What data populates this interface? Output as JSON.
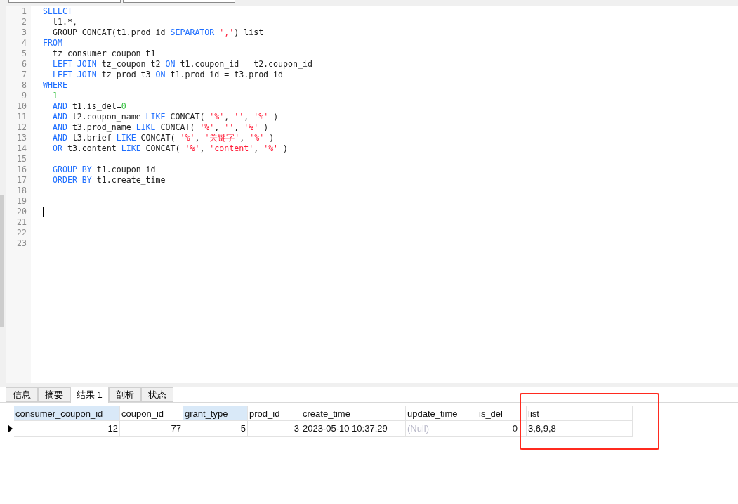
{
  "editor": {
    "lines": [
      {
        "number": "1",
        "tokens": [
          {
            "kind": "kw",
            "text": "SELECT"
          }
        ]
      },
      {
        "number": "2",
        "tokens": [
          {
            "kind": "plain",
            "text": "  t1.*,"
          }
        ]
      },
      {
        "number": "3",
        "tokens": [
          {
            "kind": "plain",
            "text": "  GROUP_CONCAT(t1.prod_id "
          },
          {
            "kind": "kw",
            "text": "SEPARATOR"
          },
          {
            "kind": "str",
            "text": " ','"
          },
          {
            "kind": "plain",
            "text": ") list"
          }
        ]
      },
      {
        "number": "4",
        "tokens": [
          {
            "kind": "kw",
            "text": "FROM"
          }
        ]
      },
      {
        "number": "5",
        "tokens": [
          {
            "kind": "plain",
            "text": "  tz_consumer_coupon t1"
          }
        ]
      },
      {
        "number": "6",
        "tokens": [
          {
            "kind": "kw",
            "text": "  LEFT JOIN"
          },
          {
            "kind": "plain",
            "text": " tz_coupon t2 "
          },
          {
            "kind": "kw",
            "text": "ON"
          },
          {
            "kind": "plain",
            "text": " t1.coupon_id = t2.coupon_id"
          }
        ]
      },
      {
        "number": "7",
        "tokens": [
          {
            "kind": "kw",
            "text": "  LEFT JOIN"
          },
          {
            "kind": "plain",
            "text": " tz_prod t3 "
          },
          {
            "kind": "kw",
            "text": "ON"
          },
          {
            "kind": "plain",
            "text": " t1.prod_id = t3.prod_id"
          }
        ]
      },
      {
        "number": "8",
        "tokens": [
          {
            "kind": "kw",
            "text": "WHERE"
          }
        ]
      },
      {
        "number": "9",
        "tokens": [
          {
            "kind": "num",
            "text": "  1"
          }
        ]
      },
      {
        "number": "10",
        "tokens": [
          {
            "kind": "kw",
            "text": "  AND"
          },
          {
            "kind": "plain",
            "text": " t1.is_del="
          },
          {
            "kind": "num",
            "text": "0"
          }
        ]
      },
      {
        "number": "11",
        "tokens": [
          {
            "kind": "kw",
            "text": "  AND"
          },
          {
            "kind": "plain",
            "text": " t2.coupon_name "
          },
          {
            "kind": "kw",
            "text": "LIKE"
          },
          {
            "kind": "plain",
            "text": " CONCAT( "
          },
          {
            "kind": "str",
            "text": "'%'"
          },
          {
            "kind": "plain",
            "text": ", "
          },
          {
            "kind": "str",
            "text": "''"
          },
          {
            "kind": "plain",
            "text": ", "
          },
          {
            "kind": "str",
            "text": "'%'"
          },
          {
            "kind": "plain",
            "text": " )"
          }
        ]
      },
      {
        "number": "12",
        "tokens": [
          {
            "kind": "kw",
            "text": "  AND"
          },
          {
            "kind": "plain",
            "text": " t3.prod_name "
          },
          {
            "kind": "kw",
            "text": "LIKE"
          },
          {
            "kind": "plain",
            "text": " CONCAT( "
          },
          {
            "kind": "str",
            "text": "'%'"
          },
          {
            "kind": "plain",
            "text": ", "
          },
          {
            "kind": "str",
            "text": "''"
          },
          {
            "kind": "plain",
            "text": ", "
          },
          {
            "kind": "str",
            "text": "'%'"
          },
          {
            "kind": "plain",
            "text": " )"
          }
        ]
      },
      {
        "number": "13",
        "tokens": [
          {
            "kind": "kw",
            "text": "  AND"
          },
          {
            "kind": "plain",
            "text": " t3.brief "
          },
          {
            "kind": "kw",
            "text": "LIKE"
          },
          {
            "kind": "plain",
            "text": " CONCAT( "
          },
          {
            "kind": "str",
            "text": "'%'"
          },
          {
            "kind": "plain",
            "text": ", "
          },
          {
            "kind": "str",
            "text": "'关键字'"
          },
          {
            "kind": "plain",
            "text": ", "
          },
          {
            "kind": "str",
            "text": "'%'"
          },
          {
            "kind": "plain",
            "text": " )"
          }
        ]
      },
      {
        "number": "14",
        "tokens": [
          {
            "kind": "kw",
            "text": "  OR"
          },
          {
            "kind": "plain",
            "text": " t3.content "
          },
          {
            "kind": "kw",
            "text": "LIKE"
          },
          {
            "kind": "plain",
            "text": " CONCAT( "
          },
          {
            "kind": "str",
            "text": "'%'"
          },
          {
            "kind": "plain",
            "text": ", "
          },
          {
            "kind": "str",
            "text": "'content'"
          },
          {
            "kind": "plain",
            "text": ", "
          },
          {
            "kind": "str",
            "text": "'%'"
          },
          {
            "kind": "plain",
            "text": " )"
          }
        ]
      },
      {
        "number": "15"
      },
      {
        "number": "16",
        "tokens": [
          {
            "kind": "kw",
            "text": "  GROUP BY"
          },
          {
            "kind": "plain",
            "text": " t1.coupon_id"
          }
        ]
      },
      {
        "number": "17",
        "tokens": [
          {
            "kind": "kw",
            "text": "  ORDER BY"
          },
          {
            "kind": "plain",
            "text": " t1.create_time"
          }
        ]
      },
      {
        "number": "18"
      },
      {
        "number": "19"
      },
      {
        "number": "20",
        "cursor": true
      },
      {
        "number": "21"
      },
      {
        "number": "22"
      },
      {
        "number": "23"
      }
    ]
  },
  "tabs": [
    {
      "label": "信息",
      "selected": false
    },
    {
      "label": "摘要",
      "selected": false
    },
    {
      "label": "结果 1",
      "selected": true
    },
    {
      "label": "剖析",
      "selected": false
    },
    {
      "label": "状态",
      "selected": false
    }
  ],
  "table": {
    "columns": [
      {
        "name": "consumer_coupon_id",
        "kind": "number",
        "highlighted": true
      },
      {
        "name": "coupon_id",
        "kind": "number",
        "highlighted": false
      },
      {
        "name": "grant_type",
        "kind": "number",
        "highlighted": true
      },
      {
        "name": "prod_id",
        "kind": "number",
        "highlighted": false
      },
      {
        "name": "create_time",
        "kind": "text",
        "highlighted": false
      },
      {
        "name": "update_time",
        "kind": "text",
        "highlighted": false
      },
      {
        "name": "is_del",
        "kind": "number",
        "highlighted": false
      },
      {
        "name": "list",
        "kind": "text",
        "highlighted": false
      }
    ],
    "rows": [
      {
        "current": true,
        "cells": [
          {
            "text": "12",
            "null": false
          },
          {
            "text": "77",
            "null": false
          },
          {
            "text": "5",
            "null": false
          },
          {
            "text": "3",
            "null": false
          },
          {
            "text": "2023-05-10 10:37:29",
            "null": false
          },
          {
            "text": "(Null)",
            "null": true
          },
          {
            "text": "0",
            "null": false
          },
          {
            "text": "3,6,9,8",
            "null": false
          }
        ]
      }
    ]
  }
}
